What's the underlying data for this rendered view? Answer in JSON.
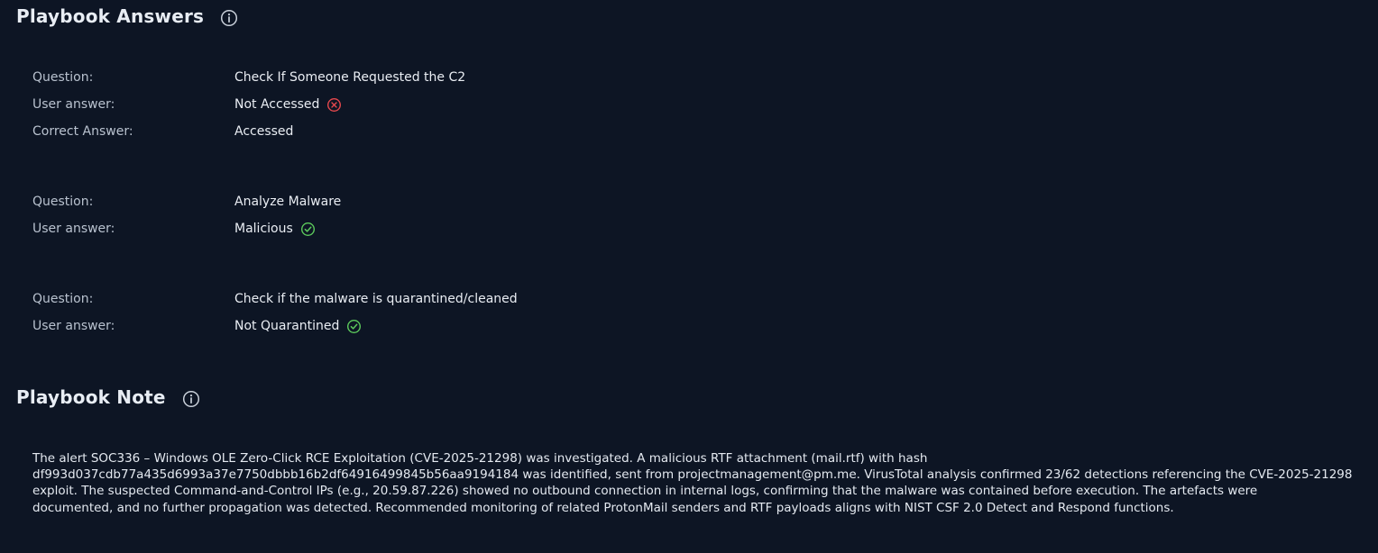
{
  "answers_section": {
    "title": "Playbook Answers",
    "info_icon": "info-circle-icon"
  },
  "labels": {
    "question": "Question:",
    "user_answer": "User answer:",
    "correct_answer": "Correct Answer:"
  },
  "qa_items": [
    {
      "question": "Check If Someone Requested the C2",
      "user_answer": "Not Accessed",
      "result": "incorrect",
      "result_icon": "x-circle-icon",
      "correct_answer": "Accessed"
    },
    {
      "question": "Analyze Malware",
      "user_answer": "Malicious",
      "result": "correct",
      "result_icon": "check-circle-icon"
    },
    {
      "question": "Check if the malware is quarantined/cleaned",
      "user_answer": "Not Quarantined",
      "result": "correct",
      "result_icon": "check-circle-icon"
    }
  ],
  "note_section": {
    "title": "Playbook Note",
    "info_icon": "info-circle-icon",
    "text": "The alert SOC336 – Windows OLE Zero-Click RCE Exploitation (CVE-2025-21298) was investigated. A malicious RTF attachment (mail.rtf) with hash\ndf993d037cdb77a435d6993a37e7750dbbb16b2df64916499845b56aa9194184 was identified, sent from projectmanagement@pm.me. VirusTotal analysis confirmed 23/62 detections referencing the CVE-2025-21298\nexploit. The suspected Command-and-Control IPs (e.g., 20.59.87.226) showed no outbound connection in internal logs, confirming that the malware was contained before execution. The artefacts were\ndocumented, and no further propagation was detected. Recommended monitoring of related ProtonMail senders and RTF payloads aligns with NIST CSF 2.0 Detect and Respond functions."
  },
  "colors": {
    "background": "#0d1524",
    "incorrect": "#e5484d",
    "correct": "#5cc95c",
    "label": "#b9c2cf",
    "icon": "#c9d0da"
  }
}
